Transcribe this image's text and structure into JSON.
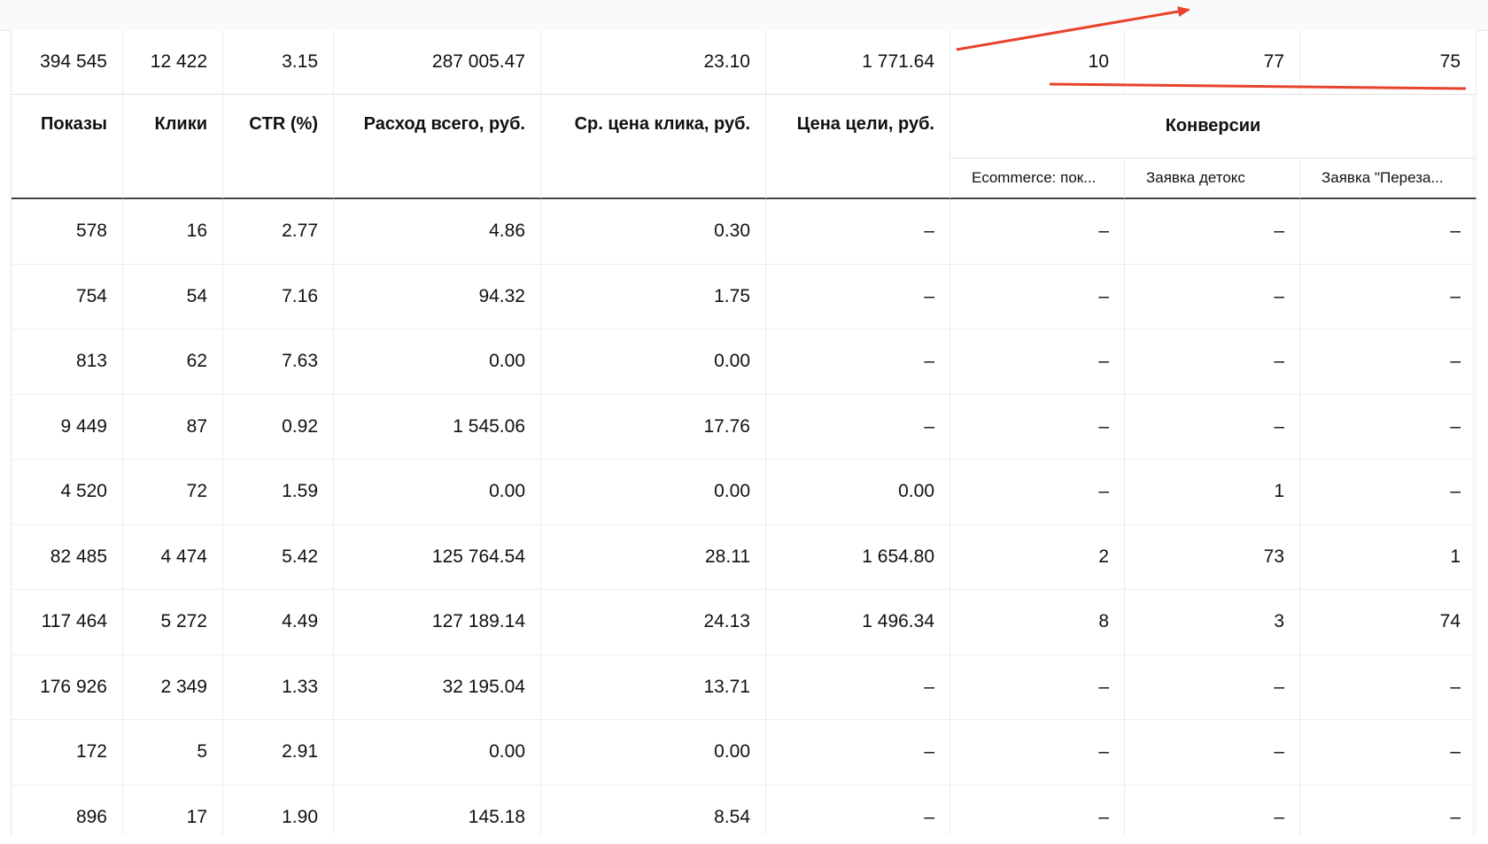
{
  "totals": [
    "394 545",
    "12 422",
    "3.15",
    "287 005.47",
    "23.10",
    "1 771.64",
    "10",
    "77",
    "75"
  ],
  "columns": [
    "Показы",
    "Клики",
    "CTR (%)",
    "Расход всего, руб.",
    "Ср. цена клика, руб.",
    "Цена цели, руб."
  ],
  "conversions": {
    "title": "Конверсии",
    "subcolumns": [
      "Ecommerce: пок...",
      "Заявка детокс",
      "Заявка \"Переза..."
    ]
  },
  "rows": [
    [
      "578",
      "16",
      "2.77",
      "4.86",
      "0.30",
      "–",
      "–",
      "–",
      "–"
    ],
    [
      "754",
      "54",
      "7.16",
      "94.32",
      "1.75",
      "–",
      "–",
      "–",
      "–"
    ],
    [
      "813",
      "62",
      "7.63",
      "0.00",
      "0.00",
      "–",
      "–",
      "–",
      "–"
    ],
    [
      "9 449",
      "87",
      "0.92",
      "1 545.06",
      "17.76",
      "–",
      "–",
      "–",
      "–"
    ],
    [
      "4 520",
      "72",
      "1.59",
      "0.00",
      "0.00",
      "0.00",
      "–",
      "1",
      "–"
    ],
    [
      "82 485",
      "4 474",
      "5.42",
      "125 764.54",
      "28.11",
      "1 654.80",
      "2",
      "73",
      "1"
    ],
    [
      "117 464",
      "5 272",
      "4.49",
      "127 189.14",
      "24.13",
      "1 496.34",
      "8",
      "3",
      "74"
    ],
    [
      "176 926",
      "2 349",
      "1.33",
      "32 195.04",
      "13.71",
      "–",
      "–",
      "–",
      "–"
    ],
    [
      "172",
      "5",
      "2.91",
      "0.00",
      "0.00",
      "–",
      "–",
      "–",
      "–"
    ],
    [
      "896",
      "17",
      "1.90",
      "145.18",
      "8.54",
      "–",
      "–",
      "–",
      "–"
    ]
  ],
  "annotation_color": "#e8432c"
}
